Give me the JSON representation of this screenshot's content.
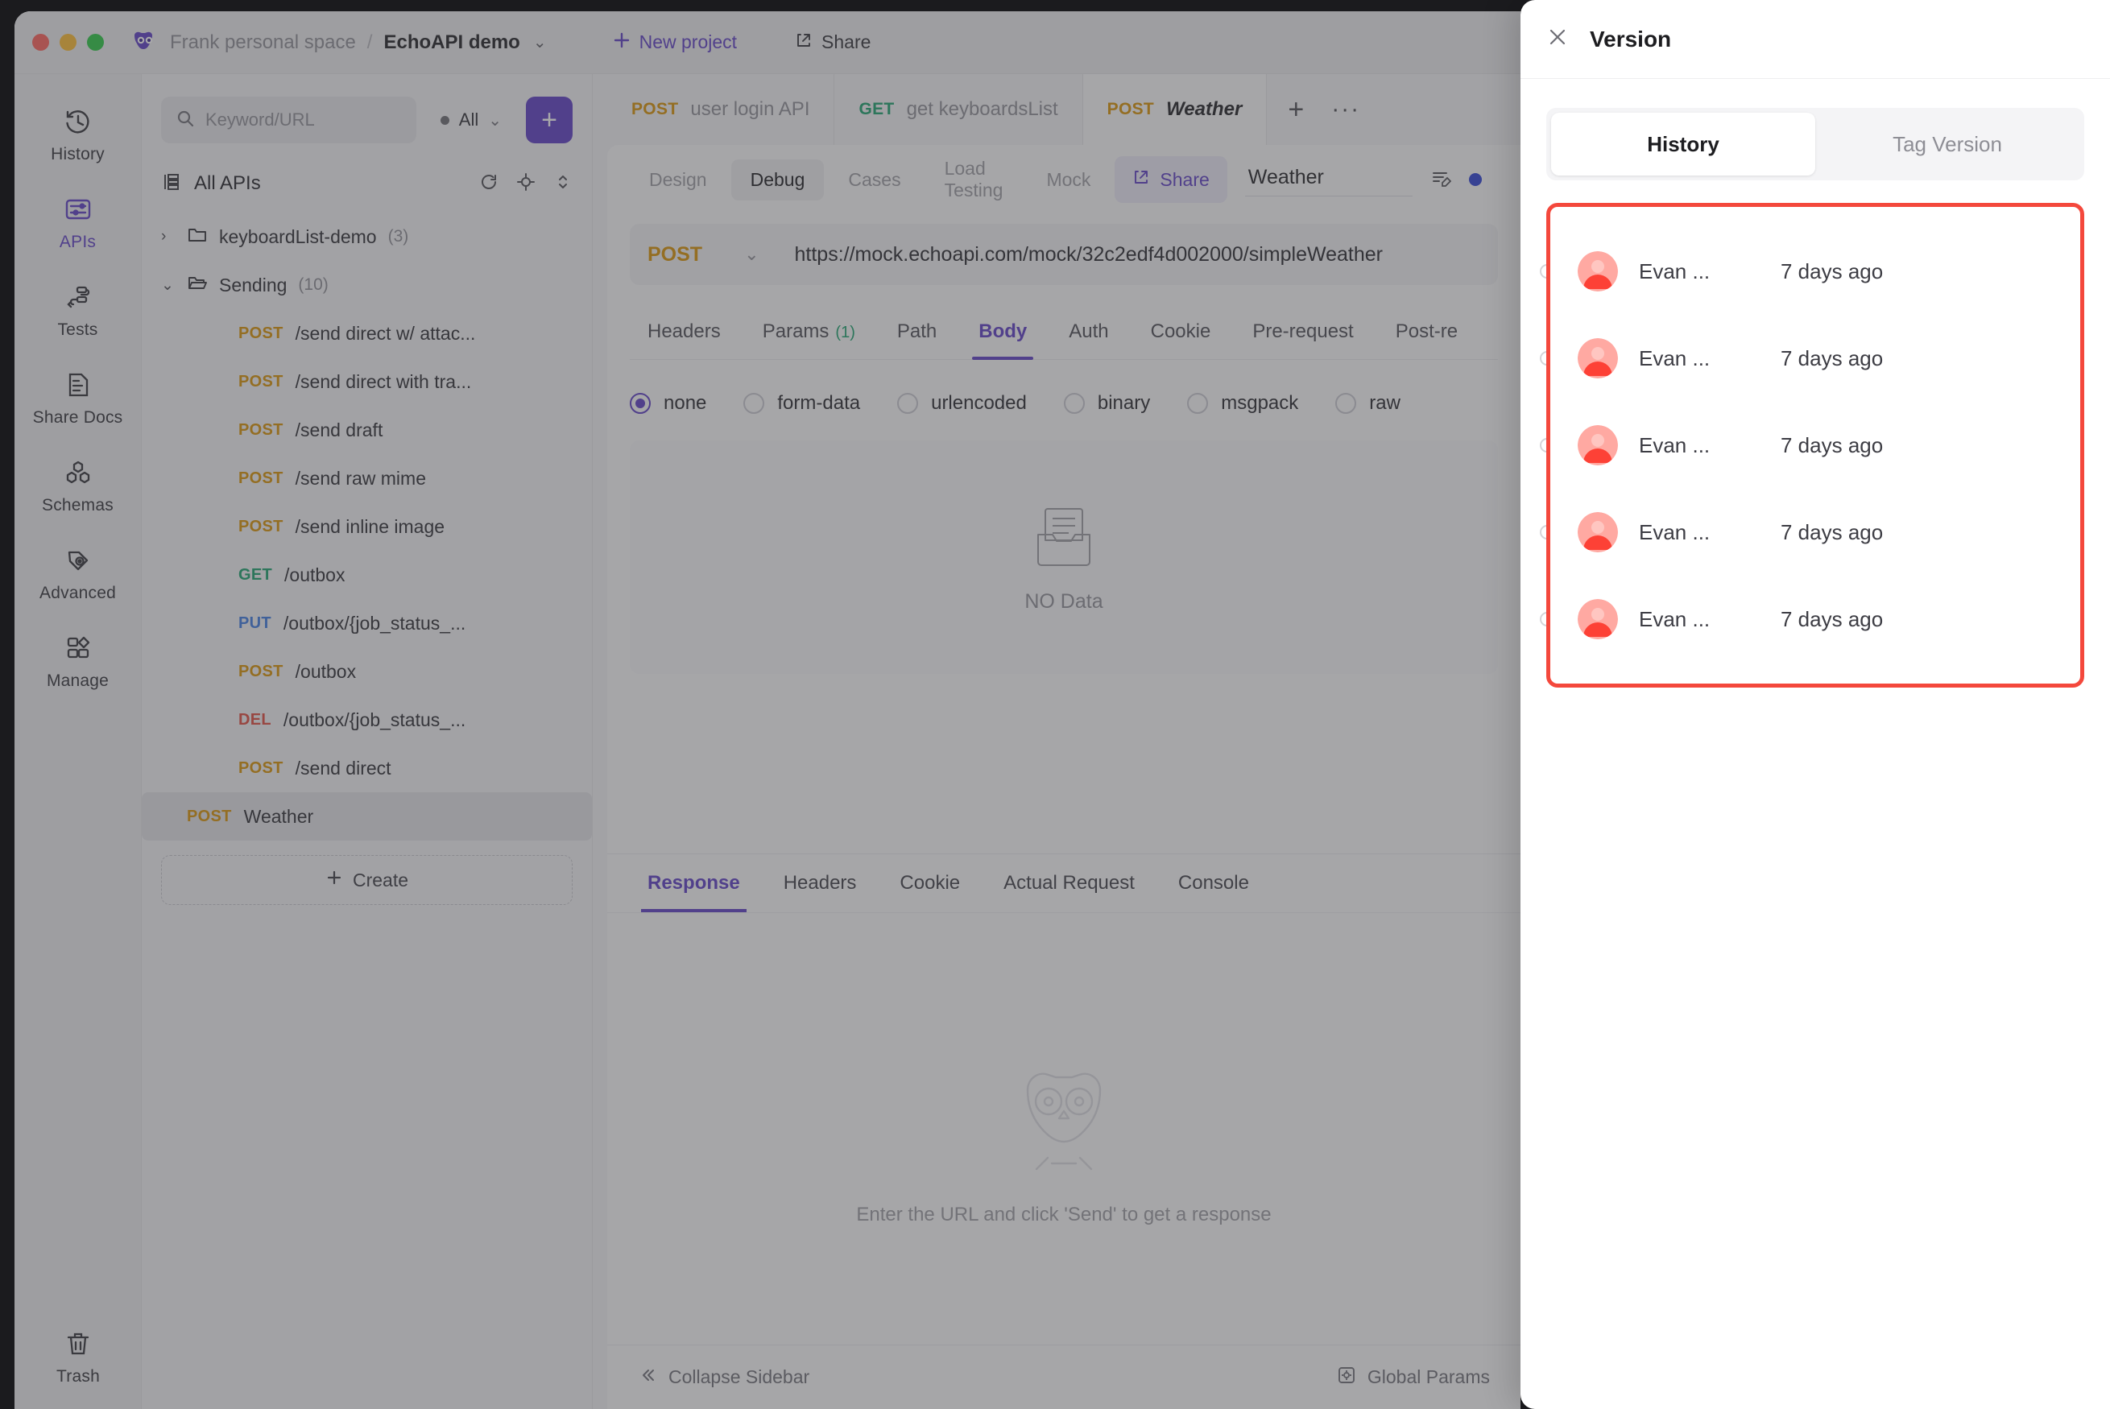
{
  "titlebar": {
    "breadcrumb_space": "Frank personal space",
    "breadcrumb_sep": "/",
    "breadcrumb_project": "EchoAPI demo",
    "caret": "⌄",
    "new_project_label": "New project",
    "new_project_icon": "plus-icon",
    "share_label": "Share",
    "share_icon": "share-icon",
    "logo_icon": "echoapi-owl-logo"
  },
  "rail": {
    "items": [
      {
        "label": "History",
        "icon": "history-clock-icon",
        "active": false
      },
      {
        "label": "APIs",
        "icon": "sliders-icon",
        "active": true
      },
      {
        "label": "Tests",
        "icon": "flow-nodes-icon",
        "active": false
      },
      {
        "label": "Share Docs",
        "icon": "document-share-icon",
        "active": false
      },
      {
        "label": "Schemas",
        "icon": "hexagons-icon",
        "active": false
      },
      {
        "label": "Advanced",
        "icon": "tag-eye-icon",
        "active": false
      },
      {
        "label": "Manage",
        "icon": "grid-shapes-icon",
        "active": false
      }
    ],
    "trash": {
      "label": "Trash",
      "icon": "trash-icon"
    }
  },
  "tree": {
    "search_placeholder": "Keyword/URL",
    "search_icon": "search-icon",
    "filter_label": "All",
    "filter_caret": "⌄",
    "add_button_icon": "plus-icon",
    "root_label": "All APIs",
    "root_icon": "api-list-icon",
    "head_actions": [
      "refresh-icon",
      "locate-icon",
      "sort-icon"
    ],
    "folders": [
      {
        "name": "keyboardList-demo",
        "count": "(3)",
        "expanded": false,
        "caret": "›",
        "icon": "folder-closed-icon"
      },
      {
        "name": "Sending",
        "count": "(10)",
        "expanded": true,
        "caret": "⌄",
        "icon": "folder-open-icon"
      }
    ],
    "items": [
      {
        "method": "POST",
        "path": "/send direct w/ attac...",
        "method_class": "m-post"
      },
      {
        "method": "POST",
        "path": "/send direct with tra...",
        "method_class": "m-post"
      },
      {
        "method": "POST",
        "path": "/send draft",
        "method_class": "m-post"
      },
      {
        "method": "POST",
        "path": "/send raw mime",
        "method_class": "m-post"
      },
      {
        "method": "POST",
        "path": "/send inline image",
        "method_class": "m-post"
      },
      {
        "method": "GET",
        "path": "/outbox",
        "method_class": "m-get"
      },
      {
        "method": "PUT",
        "path": "/outbox/{job_status_...",
        "method_class": "m-put"
      },
      {
        "method": "POST",
        "path": "/outbox",
        "method_class": "m-post"
      },
      {
        "method": "DEL",
        "path": "/outbox/{job_status_...",
        "method_class": "m-del"
      },
      {
        "method": "POST",
        "path": "/send direct",
        "method_class": "m-post"
      }
    ],
    "selected": {
      "method": "POST",
      "path": "Weather",
      "method_class": "m-post"
    },
    "create_label": "Create",
    "create_icon": "plus-icon"
  },
  "request_tabs": [
    {
      "method": "POST",
      "title": "user login API",
      "method_class": "m-post",
      "active": false
    },
    {
      "method": "GET",
      "title": "get keyboardsList",
      "method_class": "m-get",
      "active": false
    },
    {
      "method": "POST",
      "title": "Weather",
      "method_class": "m-post",
      "active": true
    }
  ],
  "tabstrip": {
    "plus": "+",
    "more": "···"
  },
  "editor": {
    "subtabs": [
      {
        "label": "Design",
        "active": false,
        "dim": true
      },
      {
        "label": "Debug",
        "active": true,
        "dim": false
      },
      {
        "label": "Cases",
        "active": false,
        "dim": true
      },
      {
        "label": "Load Testing",
        "active": false,
        "dim": true
      },
      {
        "label": "Mock",
        "active": false,
        "dim": true
      }
    ],
    "share_label": "Share",
    "share_icon": "share-icon",
    "api_name": "Weather",
    "edit_icon": "edit-lines-icon",
    "status_dot_color": "#2b3fd4",
    "method": "POST",
    "method_caret": "⌄",
    "url": "https://mock.echoapi.com/mock/32c2edf4d002000/simpleWeather",
    "param_tabs": [
      {
        "label": "Headers",
        "badge": "",
        "active": false
      },
      {
        "label": "Params",
        "badge": "(1)",
        "active": false
      },
      {
        "label": "Path",
        "badge": "",
        "active": false
      },
      {
        "label": "Body",
        "badge": "",
        "active": true
      },
      {
        "label": "Auth",
        "badge": "",
        "active": false
      },
      {
        "label": "Cookie",
        "badge": "",
        "active": false
      },
      {
        "label": "Pre-request",
        "badge": "",
        "active": false
      },
      {
        "label": "Post-re",
        "badge": "",
        "active": false
      }
    ],
    "body_types": [
      {
        "label": "none",
        "selected": true
      },
      {
        "label": "form-data",
        "selected": false
      },
      {
        "label": "urlencoded",
        "selected": false
      },
      {
        "label": "binary",
        "selected": false
      },
      {
        "label": "msgpack",
        "selected": false
      },
      {
        "label": "raw",
        "selected": false
      }
    ],
    "body_empty_label": "NO Data",
    "body_empty_icon": "empty-inbox-icon"
  },
  "response": {
    "tabs": [
      {
        "label": "Response",
        "active": true
      },
      {
        "label": "Headers",
        "active": false
      },
      {
        "label": "Cookie",
        "active": false
      },
      {
        "label": "Actual Request",
        "active": false
      },
      {
        "label": "Console",
        "active": false
      }
    ],
    "empty_hint": "Enter the URL and click 'Send' to get a response",
    "empty_icon": "owl-watermark-icon"
  },
  "statusbar": {
    "collapse_label": "Collapse Sidebar",
    "collapse_icon": "chevrons-left-icon",
    "global_params_label": "Global Params",
    "global_params_icon": "gear-box-icon"
  },
  "drawer": {
    "close_icon": "close-icon",
    "title": "Version",
    "tabs": [
      {
        "label": "History",
        "active": true
      },
      {
        "label": "Tag Version",
        "active": false
      }
    ],
    "highlight_color": "#f4483c",
    "history": [
      {
        "name": "Evan ...",
        "time": "7 days ago",
        "avatar_icon": "user-avatar-icon"
      },
      {
        "name": "Evan ...",
        "time": "7 days ago",
        "avatar_icon": "user-avatar-icon"
      },
      {
        "name": "Evan ...",
        "time": "7 days ago",
        "avatar_icon": "user-avatar-icon"
      },
      {
        "name": "Evan ...",
        "time": "7 days ago",
        "avatar_icon": "user-avatar-icon"
      },
      {
        "name": "Evan ...",
        "time": "7 days ago",
        "avatar_icon": "user-avatar-icon"
      }
    ]
  }
}
